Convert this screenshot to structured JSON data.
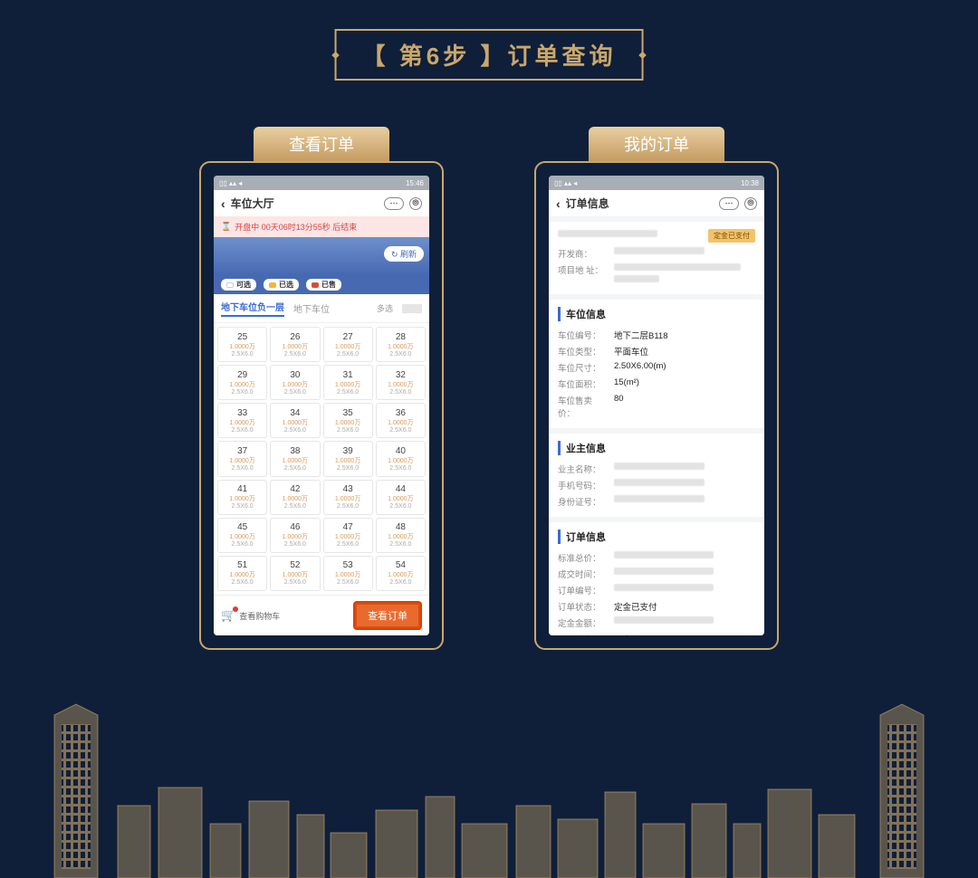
{
  "heading": "【 第6步 】订单查询",
  "left": {
    "tabLabel": "查看订单",
    "statusTime": "15:46",
    "title": "车位大厅",
    "countdown": "开盘中  00天06时13分55秒 后结束",
    "refresh": "刷新",
    "legend": {
      "a": "可选",
      "b": "已选",
      "c": "已售"
    },
    "tabs": {
      "active": "地下车位负一层",
      "other": "地下车位",
      "count": "多选"
    },
    "cells": [
      {
        "n": "25",
        "p": "1.0000万",
        "d": "2.5X6.0"
      },
      {
        "n": "26",
        "p": "1.0000万",
        "d": "2.5X6.0"
      },
      {
        "n": "27",
        "p": "1.0000万",
        "d": "2.5X6.0"
      },
      {
        "n": "28",
        "p": "1.0000万",
        "d": "2.5X6.0"
      },
      {
        "n": "29",
        "p": "1.0000万",
        "d": "2.5X6.0"
      },
      {
        "n": "30",
        "p": "1.0000万",
        "d": "2.5X6.0"
      },
      {
        "n": "31",
        "p": "1.0000万",
        "d": "2.5X6.0"
      },
      {
        "n": "32",
        "p": "1.0000万",
        "d": "2.5X6.0"
      },
      {
        "n": "33",
        "p": "1.0000万",
        "d": "2.5X6.0"
      },
      {
        "n": "34",
        "p": "1.0000万",
        "d": "2.5X6.0"
      },
      {
        "n": "35",
        "p": "1.0000万",
        "d": "2.5X6.0"
      },
      {
        "n": "36",
        "p": "1.0000万",
        "d": "2.5X6.0"
      },
      {
        "n": "37",
        "p": "1.0000万",
        "d": "2.5X6.0"
      },
      {
        "n": "38",
        "p": "1.0000万",
        "d": "2.5X6.0"
      },
      {
        "n": "39",
        "p": "1.0000万",
        "d": "2.5X6.0"
      },
      {
        "n": "40",
        "p": "1.0000万",
        "d": "2.5X6.0"
      },
      {
        "n": "41",
        "p": "1.0000万",
        "d": "2.5X6.0"
      },
      {
        "n": "42",
        "p": "1.0000万",
        "d": "2.5X6.0"
      },
      {
        "n": "43",
        "p": "1.0000万",
        "d": "2.5X6.0"
      },
      {
        "n": "44",
        "p": "1.0000万",
        "d": "2.5X6.0"
      },
      {
        "n": "45",
        "p": "1.0000万",
        "d": "2.5X6.0"
      },
      {
        "n": "46",
        "p": "1.0000万",
        "d": "2.5X6.0"
      },
      {
        "n": "47",
        "p": "1.0000万",
        "d": "2.5X6.0"
      },
      {
        "n": "48",
        "p": "1.0000万",
        "d": "2.5X6.0"
      },
      {
        "n": "51",
        "p": "1.0000万",
        "d": "2.5X6.0"
      },
      {
        "n": "52",
        "p": "1.0000万",
        "d": "2.5X6.0"
      },
      {
        "n": "53",
        "p": "1.0000万",
        "d": "2.5X6.0"
      },
      {
        "n": "54",
        "p": "1.0000万",
        "d": "2.5X6.0"
      }
    ],
    "cartText": "查看购物车",
    "orderBtn": "查看订单"
  },
  "right": {
    "tabLabel": "我的订单",
    "statusTime": "10:38",
    "title": "订单信息",
    "badge": "定金已支付",
    "devLabel": "开发商：",
    "addrLabel": "项目地\n址：",
    "sec1": "车位信息",
    "sec1rows": [
      {
        "k": "车位编号：",
        "v": "地下二层B118"
      },
      {
        "k": "车位类型：",
        "v": "平面车位"
      },
      {
        "k": "车位尺寸：",
        "v": "2.50X6.00(m)"
      },
      {
        "k": "车位面积：",
        "v": "15(m²)"
      },
      {
        "k": "车位售卖价：",
        "v": "80"
      }
    ],
    "sec2": "业主信息",
    "sec2rows": [
      {
        "k": "业主名称："
      },
      {
        "k": "手机号码："
      },
      {
        "k": "身份证号："
      }
    ],
    "sec3": "订单信息",
    "sec3rows": [
      {
        "k": "标准总价："
      },
      {
        "k": "成交时间："
      },
      {
        "k": "订单编号："
      },
      {
        "k": "订单状态：",
        "v": "定金已支付"
      },
      {
        "k": "定金金额："
      },
      {
        "k": "定金状态：",
        "v": "已支付"
      }
    ]
  }
}
